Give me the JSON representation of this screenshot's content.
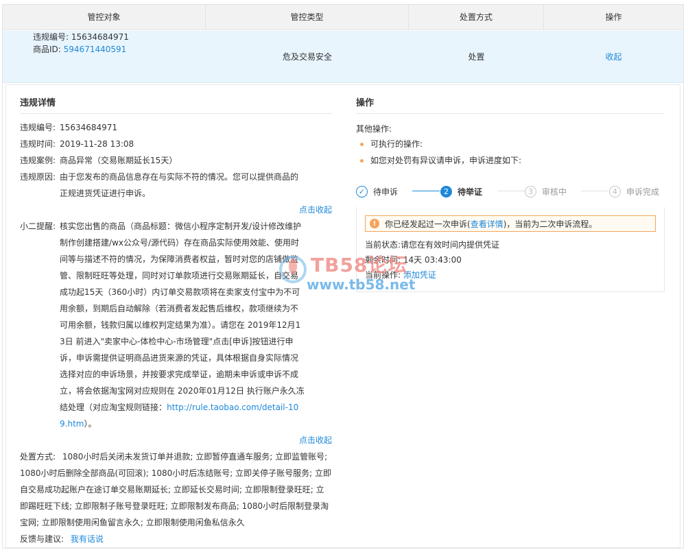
{
  "table": {
    "headers": [
      "管控对象",
      "管控类型",
      "处置方式",
      "操作"
    ],
    "row": {
      "violation_no_label": "违规编号:",
      "violation_no": "15634684971",
      "product_id_label": "商品ID:",
      "product_id": "594671440591",
      "type": "危及交易安全",
      "method": "处置",
      "action": "收起"
    }
  },
  "detail": {
    "title": "违规详情",
    "fields": [
      {
        "label": "违规编号:",
        "value": "15634684971"
      },
      {
        "label": "违规时间:",
        "value": "2019-11-28 13:08"
      },
      {
        "label": "违规案例:",
        "value": "商品异常（交易账期延长15天）"
      },
      {
        "label": "违规原因:",
        "value": "由于您发布的商品信息存在与实际不符的情况。您可以提供商品的正规进货凭证进行申诉。"
      }
    ],
    "collapse_label": "点击收起",
    "reminder_label": "小二提醒:",
    "reminder_text": "核实您出售的商品（商品标题：微信小程序定制开发/设计修改维护制作创建搭建/wx公众号/源代码）存在商品实际使用效能、使用时间等与描述不符的情况，为保障消费者权益，暂时对您的店铺做监管、限制旺旺等处理，同时对订单款项进行交易账期延长，自交易成功起15天（360小时）内订单交易款项将在卖家支付宝中为不可用余额，到期后自动解除（若消费者发起售后维权，款项继续为不可用余额，钱款归属以维权判定结果为准）。请您在 2019年12月13日 前进入\"卖家中心-体检中心-市场管理\"点击[申诉]按钮进行申诉，申诉需提供证明商品进货来源的凭证，具体根据自身实际情况选择对应的申诉场景，并按要求完成举证，逾期未申诉或申诉不成立，将会依据淘宝网对应规则在 2020年01月12日 执行账户永久冻结处理（对应淘宝规则链接：",
    "reminder_link": "http://rule.taobao.com/detail-109.htm",
    "reminder_end": "）。",
    "handling_label": "处置方式:",
    "handling_text": "1080小时后关闭未发货订单并退款; 立即暂停直通车服务; 立即监管账号; 1080小时后删除全部商品(可回滚); 1080小时后冻结账号; 立即关停子账号服务; 立即自交易成功起账户在途订单交易账期延长; 立即延长交易时间; 立即限制登录旺旺; 立即踢旺旺下线; 立即限制子账号登录旺旺; 立即限制发布商品; 1080小时后限制登录淘宝网; 立即限制使用闲鱼留言永久; 立即限制使用闲鱼私信永久",
    "feedback_label": "反馈与建议:",
    "feedback_link": "我有话说"
  },
  "operations": {
    "title": "操作",
    "other_label": "其他操作:",
    "bullets": [
      "可执行的操作:",
      "如您对处罚有异议请申诉，申诉进度如下:"
    ],
    "steps": [
      {
        "num": "✓",
        "label": "待申诉",
        "state": "done"
      },
      {
        "num": "2",
        "label": "待举证",
        "state": "active"
      },
      {
        "num": "3",
        "label": "审核中",
        "state": "todo"
      },
      {
        "num": "4",
        "label": "申诉完成",
        "state": "todo"
      }
    ],
    "warning_pre": "你已经发起过一次申诉(",
    "warning_link": "查看详情",
    "warning_post": ")，当前为二次申诉流程。",
    "status_label": "当前状态:",
    "status_value": "请您在有效时间内提供凭证",
    "remain_label": "剩余时间:",
    "remain_value": "14天 03:43:00",
    "op_label": "当前操作:",
    "op_link": "添加凭证"
  },
  "watermark": {
    "title": "TB58论坛",
    "url": "www.tb58.net"
  },
  "colors": {
    "link": "#1e88d9",
    "row_bg": "#e8f5fd",
    "header_bg": "#f2f2f2",
    "warning": "#f4a55c"
  }
}
